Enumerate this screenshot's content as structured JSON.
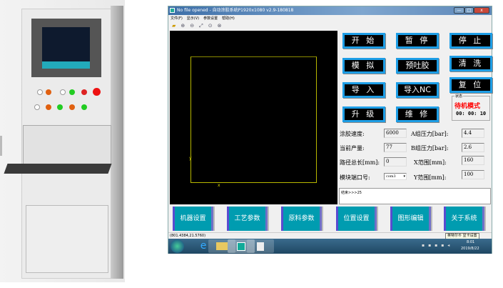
{
  "window": {
    "title": "No file opened - 自动涂胶系统P1920x1080 v2.9-180818",
    "minimize": "—",
    "maximize": "□",
    "close": "x"
  },
  "menu": [
    "文件(F)",
    "显示(V)",
    "参数设置",
    "帮助(H)"
  ],
  "toolbar": [
    "open-folder-icon",
    "zoom-in-icon",
    "zoom-out-icon",
    "zoom-fit-icon",
    "zoom-window-icon",
    "zoom-prev-icon"
  ],
  "canvas": {
    "x_marker": "x",
    "y_marker": "y"
  },
  "controls": [
    {
      "id": "start",
      "label": "开 始"
    },
    {
      "id": "pause",
      "label": "暂 停"
    },
    {
      "id": "stop",
      "label": "停 止"
    },
    {
      "id": "simulate",
      "label": "模 拟"
    },
    {
      "id": "pre-dispense",
      "label": "预吐胶"
    },
    {
      "id": "clean",
      "label": "清 洗"
    },
    {
      "id": "import",
      "label": "导 入"
    },
    {
      "id": "import-nc",
      "label": "导入NC"
    },
    {
      "id": "reset",
      "label": "复 位"
    },
    {
      "id": "upgrade",
      "label": "升 级"
    },
    {
      "id": "maintain",
      "label": "维 修"
    }
  ],
  "status": {
    "legend": "状态",
    "mode": "待机模式",
    "timer": "00: 00: 10",
    "mode_color": "#ff0000"
  },
  "params": {
    "speed_label": "涂胶速度:",
    "speed": "6000",
    "output_label": "当前产量:",
    "output": "77",
    "path_label": "路径总长[mm]:",
    "path": "0",
    "port_label": "模块端口号:",
    "port": "com3",
    "pa_label": "A组压力[bar]:",
    "pa": "4.4",
    "pb_label": "B组压力[bar]:",
    "pb": "2.6",
    "xr_label": "X范围[mm]:",
    "xr": "160",
    "yr_label": "Y范围[mm]:",
    "yr": "100"
  },
  "log": "结束>>>25",
  "nav": [
    "机器设置",
    "工艺参数",
    "原料参数",
    "位置设置",
    "图形编辑",
    "关于系统"
  ],
  "statusbar": {
    "coords": "(801.4384,21.5760)",
    "tooltip": "英特尔® 显卡设置"
  },
  "taskbar": {
    "time": "8:01",
    "date": "2019/8/22"
  },
  "colors": {
    "button_border": "#1e9ee6",
    "nav_bg": "#009cb0",
    "canvas_bg": "#000000",
    "path": "#b8b800"
  }
}
